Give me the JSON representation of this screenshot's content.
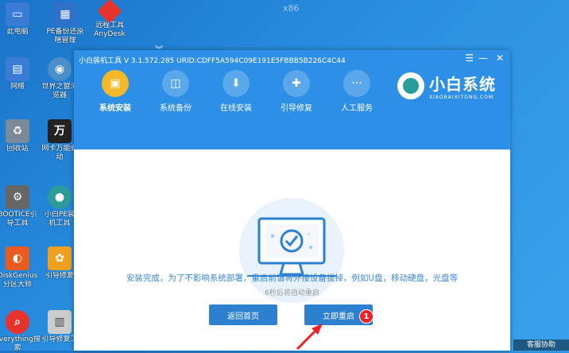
{
  "desktop": {
    "top_text": "x86",
    "icons": [
      {
        "label": "此电脑",
        "icon": "computer-icon",
        "color": "#3a7bd5"
      },
      {
        "label": "PE备份还原",
        "label2": "啥管理",
        "icon": "backup-icon",
        "color": "#2f70c8"
      },
      {
        "label": "远程工具",
        "label2": "AnyDesk",
        "icon": "anydesk-icon",
        "color": "#e8322c"
      },
      {
        "label": "网络",
        "icon": "network-icon",
        "color": "#3a7bd5"
      },
      {
        "label": "世界之窗浏",
        "label2": "览器",
        "icon": "browser-icon",
        "color": "#4a90c8"
      },
      {
        "label": "回收站",
        "icon": "recycle-bin-icon",
        "color": "#7a8a9a"
      },
      {
        "label": "网卡万能驱",
        "label2": "动",
        "icon": "driver-icon",
        "color": "#222222"
      },
      {
        "label": "BOOTICE引",
        "label2": "导工具",
        "icon": "bootice-icon",
        "color": "#666666"
      },
      {
        "label": "小白PE装",
        "label2": "机工具",
        "icon": "xiaobai-icon",
        "color": "#2a9d9a"
      },
      {
        "label": "DiskGenius",
        "label2": "分区大师",
        "icon": "diskgenius-icon",
        "color": "#e85c20"
      },
      {
        "label": "引导修复",
        "icon": "pinwheel-icon",
        "color": "#f0a020"
      },
      {
        "label": "Everything搜",
        "label2": "索",
        "icon": "everything-icon",
        "color": "#e8322c"
      },
      {
        "label": "引导修复工",
        "icon": "repair-icon",
        "color": "#cccccc"
      }
    ],
    "chevron": "︾",
    "taskbar_text": "客服协助"
  },
  "window": {
    "title": "小白装机工具 V 3.1.572.285 URID:CDFF5A594C09E191E5FBBB5B226C4C44",
    "controls": {
      "menu": "☰",
      "minimize": "—",
      "close": "✕"
    },
    "nav": [
      {
        "label": "系统安装",
        "icon": "install-icon",
        "glyph": "▣",
        "active": true
      },
      {
        "label": "系统备份",
        "icon": "backup-icon",
        "glyph": "◫",
        "active": false
      },
      {
        "label": "在线安装",
        "icon": "download-icon",
        "glyph": "⬇",
        "active": false
      },
      {
        "label": "引导修复",
        "icon": "repair-icon",
        "glyph": "✚",
        "active": false
      },
      {
        "label": "人工服务",
        "icon": "chat-icon",
        "glyph": "···",
        "active": false
      }
    ],
    "brand": {
      "name": "小白系统",
      "sub": "XIAOBAIXITONG.COM"
    },
    "message": "安装完成，为了不影响系统部署，重启前请将外接设备拔掉，例如U盘，移动硬盘，光盘等",
    "countdown": "6秒后将自动重启",
    "buttons": {
      "home": "返回首页",
      "restart": "立即重启"
    },
    "badge": "1",
    "colors": {
      "accent": "#2d8fe6",
      "active_nav": "#f5b828",
      "button": "#2d7fd0",
      "badge": "#e22222"
    }
  }
}
